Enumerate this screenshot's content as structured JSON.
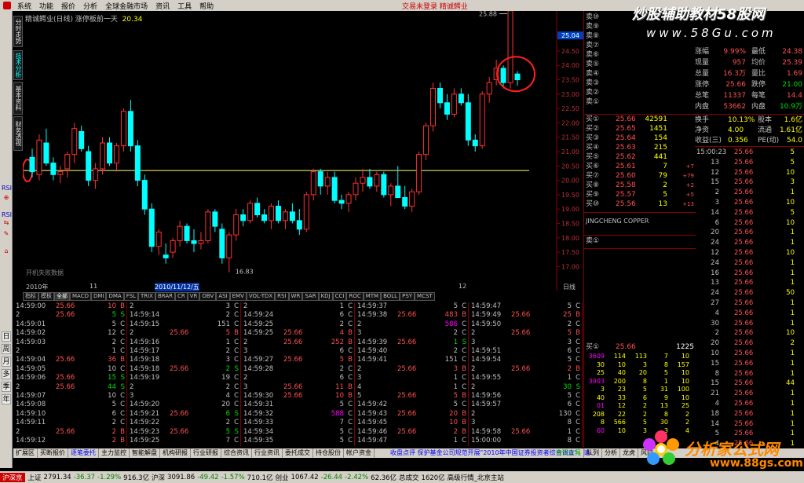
{
  "menu": {
    "items": [
      "系统",
      "功能",
      "报价",
      "分析",
      "全球金融市场",
      "资讯",
      "工具",
      "帮助"
    ],
    "notice": "交易未登录  精诚鳄业"
  },
  "chart": {
    "title": "精诚鳄业(日线) 涨停板前一天",
    "title_value": "20.34",
    "watermark": "开机失败数据",
    "high_label": "25.88",
    "low_label": "16.83",
    "level": "20.34",
    "price_ticks": [
      "25.04",
      "24.50",
      "24.00",
      "23.50",
      "23.00",
      "22.50",
      "22.00",
      "21.50",
      "21.00",
      "20.50",
      "20.00",
      "19.50",
      "19.00",
      "18.50",
      "18.00",
      "17.50",
      "17.00"
    ],
    "date_left": "2010年",
    "date_mid1": "11",
    "date_sel": "2010/11/12/五",
    "date_mid2": "12",
    "date_right": "日线",
    "colors": {
      "up": "#ff3030",
      "down": "#00ffff",
      "level": "#ffff80"
    }
  },
  "chart_data": {
    "type": "candlestick",
    "title": "精诚鳄业(日线)",
    "ylim": [
      16.6,
      25.4
    ],
    "candles": [
      [
        20.8,
        21.1,
        20.1,
        20.3
      ],
      [
        20.2,
        21.6,
        20.0,
        21.4
      ],
      [
        21.3,
        21.8,
        20.5,
        20.6
      ],
      [
        20.6,
        20.8,
        20.0,
        20.2
      ],
      [
        20.2,
        20.5,
        19.9,
        20.3
      ],
      [
        20.4,
        21.0,
        20.1,
        20.9
      ],
      [
        20.9,
        22.0,
        20.6,
        21.8
      ],
      [
        21.7,
        21.9,
        21.0,
        21.1
      ],
      [
        21.0,
        21.2,
        19.8,
        20.0
      ],
      [
        20.0,
        20.6,
        19.7,
        20.4
      ],
      [
        20.4,
        21.5,
        20.2,
        21.3
      ],
      [
        21.3,
        21.5,
        20.5,
        20.6
      ],
      [
        20.6,
        21.3,
        20.3,
        21.2
      ],
      [
        21.2,
        22.5,
        21.0,
        22.4
      ],
      [
        22.4,
        22.8,
        21.0,
        21.2
      ],
      [
        21.2,
        21.4,
        19.8,
        20.0
      ],
      [
        20.0,
        20.2,
        18.8,
        19.0
      ],
      [
        19.0,
        19.2,
        17.5,
        17.7
      ],
      [
        17.7,
        18.3,
        17.4,
        18.2
      ],
      [
        17.4,
        17.8,
        17.1,
        17.3
      ],
      [
        17.5,
        18.0,
        17.3,
        17.9
      ],
      [
        17.9,
        18.6,
        17.7,
        18.4
      ],
      [
        18.4,
        18.5,
        17.8,
        17.9
      ],
      [
        17.9,
        18.3,
        17.5,
        17.8
      ],
      [
        17.8,
        18.2,
        17.6,
        17.9
      ],
      [
        17.9,
        19.0,
        17.8,
        18.9
      ],
      [
        18.9,
        19.0,
        18.2,
        18.4
      ],
      [
        18.3,
        18.5,
        17.1,
        17.3
      ],
      [
        17.3,
        18.2,
        16.8,
        18.1
      ],
      [
        18.1,
        19.0,
        17.9,
        18.8
      ],
      [
        18.8,
        19.0,
        18.4,
        18.6
      ],
      [
        18.6,
        19.3,
        18.5,
        19.2
      ],
      [
        19.2,
        19.4,
        18.7,
        18.8
      ],
      [
        18.8,
        19.0,
        18.5,
        18.6
      ],
      [
        18.6,
        19.2,
        18.3,
        19.1
      ],
      [
        19.1,
        19.3,
        18.5,
        18.6
      ],
      [
        18.6,
        19.0,
        18.3,
        18.9
      ],
      [
        18.9,
        19.2,
        18.5,
        18.6
      ],
      [
        18.6,
        19.0,
        18.1,
        18.3
      ],
      [
        18.3,
        19.6,
        18.2,
        19.5
      ],
      [
        19.5,
        20.4,
        19.3,
        20.3
      ],
      [
        20.3,
        20.4,
        19.5,
        19.8
      ],
      [
        19.8,
        20.3,
        19.5,
        20.1
      ],
      [
        20.1,
        20.3,
        19.2,
        19.3
      ],
      [
        19.3,
        19.5,
        19.0,
        19.2
      ],
      [
        19.2,
        19.6,
        18.9,
        19.5
      ],
      [
        19.5,
        20.1,
        19.3,
        19.9
      ],
      [
        19.9,
        20.4,
        19.6,
        20.1
      ],
      [
        20.1,
        20.4,
        19.7,
        19.8
      ],
      [
        19.8,
        20.3,
        19.6,
        20.2
      ],
      [
        20.2,
        20.3,
        19.4,
        19.5
      ],
      [
        19.5,
        19.9,
        19.1,
        19.8
      ],
      [
        19.8,
        20.5,
        19.4,
        19.4
      ],
      [
        19.4,
        19.8,
        19.0,
        19.1
      ],
      [
        19.1,
        19.7,
        18.9,
        19.6
      ],
      [
        19.6,
        21.0,
        19.5,
        20.9
      ],
      [
        20.9,
        22.0,
        20.7,
        21.9
      ],
      [
        21.9,
        23.4,
        21.7,
        23.2
      ],
      [
        23.2,
        23.4,
        22.5,
        22.7
      ],
      [
        22.7,
        23.0,
        22.1,
        22.3
      ],
      [
        22.3,
        23.2,
        22.2,
        23.0
      ],
      [
        23.0,
        23.2,
        22.6,
        22.7
      ],
      [
        22.7,
        23.0,
        21.2,
        21.4
      ],
      [
        21.4,
        21.6,
        21.0,
        21.2
      ],
      [
        21.2,
        23.1,
        21.1,
        23.0
      ],
      [
        23.0,
        23.6,
        22.7,
        23.4
      ],
      [
        23.5,
        24.2,
        23.3,
        23.9
      ],
      [
        23.9,
        24.0,
        23.2,
        23.4
      ],
      [
        23.4,
        25.9,
        23.2,
        25.9
      ],
      [
        23.7,
        23.8,
        23.3,
        23.5
      ]
    ]
  },
  "indicators": [
    "指标",
    "模板",
    "全部",
    "MACD",
    "DMI",
    "DMA",
    "FSL",
    "TRIX",
    "BRAR",
    "CR",
    "VR",
    "OBV",
    "ASI",
    "EMV",
    "VOL-TDX",
    "RSI",
    "WR",
    "SAR",
    "KDJ",
    "CCI",
    "ROC",
    "MTM",
    "BOLL",
    "PSY",
    "MCST"
  ],
  "vtabs": [
    "分时走势",
    "技术分析",
    "基本资料",
    "财务透视"
  ],
  "ltools": [
    "RSI",
    "RSI"
  ],
  "lkeys": [
    "日",
    "周",
    "月",
    "多",
    "季",
    "年"
  ],
  "ticks": [
    [
      [
        "14:59:00",
        "25.66",
        "10",
        "B"
      ],
      [
        "2",
        "25.66",
        "5",
        "S"
      ],
      [
        "14:59:01",
        "",
        "5",
        "C"
      ],
      [
        "14:59:02",
        "",
        "12",
        "C"
      ],
      [
        "14:59:03",
        "",
        "2",
        "C"
      ],
      [
        "2",
        "",
        "1",
        "C"
      ],
      [
        "14:59:04",
        "25.66",
        "36",
        "B"
      ],
      [
        "14:59:05",
        "",
        "10",
        "C"
      ],
      [
        "14:59:06",
        "25.66",
        "15",
        "S"
      ],
      [
        "2",
        "25.66",
        "44",
        "S"
      ],
      [
        "14:59:07",
        "",
        "10",
        "C"
      ],
      [
        "14:59:08",
        "",
        "5",
        "C"
      ],
      [
        "14:59:10",
        "",
        "6",
        "C"
      ],
      [
        "14:59:11",
        "",
        "2",
        "C"
      ],
      [
        "2",
        "25.66",
        "2",
        "B"
      ],
      [
        "14:59:12",
        "",
        "2",
        "B"
      ]
    ],
    [
      [
        "2",
        "",
        "3",
        "C"
      ],
      [
        "14:59:14",
        "",
        "2",
        "C"
      ],
      [
        "14:59:15",
        "",
        "151",
        "C"
      ],
      [
        "2",
        "25.66",
        "5",
        "B"
      ],
      [
        "14:59:16",
        "",
        "1",
        "C"
      ],
      [
        "14:59:17",
        "",
        "2",
        "C"
      ],
      [
        "14:59:18",
        "",
        "3",
        "C"
      ],
      [
        "14:59:18",
        "25.66",
        "2",
        "S"
      ],
      [
        "14:59:19",
        "",
        "19",
        "C"
      ],
      [
        "2",
        "",
        "2",
        "C"
      ],
      [
        "3",
        "",
        "4",
        "C"
      ],
      [
        "14:59:20",
        "",
        "20",
        "C"
      ],
      [
        "14:59:21",
        "25.66",
        "6",
        "S"
      ],
      [
        "14:59:22",
        "",
        "2",
        "C"
      ],
      [
        "14:59:23",
        "25.66",
        "5",
        "S"
      ],
      [
        "14:59:25",
        "",
        "7",
        "C"
      ]
    ],
    [
      [
        "2",
        "",
        "1",
        "C"
      ],
      [
        "14:59:24",
        "",
        "6",
        "C"
      ],
      [
        "14:59:25",
        "",
        "2",
        "C"
      ],
      [
        "14:59:25",
        "25.66",
        "4",
        "B"
      ],
      [
        "2",
        "25.66",
        "252",
        "B"
      ],
      [
        "3",
        "",
        "6",
        "C"
      ],
      [
        "14:59:27",
        "25.66",
        "5",
        "B"
      ],
      [
        "14:59:28",
        "",
        "2",
        "C"
      ],
      [
        "2",
        "",
        "6",
        "C"
      ],
      [
        "3",
        "25.66",
        "11",
        "B"
      ],
      [
        "14:59:30",
        "25.66",
        "10",
        "B"
      ],
      [
        "14:59:31",
        "",
        "5",
        "C"
      ],
      [
        "14:59:32",
        "",
        "588",
        "C"
      ],
      [
        "14:59:33",
        "",
        "7",
        "C"
      ],
      [
        "14:59:34",
        "",
        "5",
        "C"
      ],
      [
        "14:59:35",
        "",
        "5",
        "C"
      ]
    ],
    [
      [
        "14:59:37",
        "",
        "5",
        "C"
      ],
      [
        "14:59:38",
        "25.66",
        "483",
        "B"
      ],
      [
        "2",
        "",
        "586",
        "C"
      ],
      [
        "3",
        "",
        "2",
        "C"
      ],
      [
        "14:59:39",
        "25.66",
        "1",
        "S"
      ],
      [
        "14:59:40",
        "",
        "2",
        "C"
      ],
      [
        "14:59:41",
        "",
        "151",
        "C"
      ],
      [
        "2",
        "25.66",
        "3",
        "B"
      ],
      [
        "3",
        "",
        "1",
        "C"
      ],
      [
        "4",
        "",
        "1",
        "C"
      ],
      [
        "5",
        "25.66",
        "5",
        "B"
      ],
      [
        "14:59:42",
        "",
        "5",
        "C"
      ],
      [
        "14:59:43",
        "25.66",
        "20",
        "B"
      ],
      [
        "14:59:45",
        "",
        "10",
        "B"
      ],
      [
        "14:59:46",
        "25.66",
        "2",
        "B"
      ],
      [
        "14:59:47",
        "",
        "1",
        "C"
      ]
    ],
    [
      [
        "14:59:47",
        "",
        "5",
        "C"
      ],
      [
        "14:59:49",
        "25.66",
        "25",
        "B"
      ],
      [
        "14:59:50",
        "",
        "2",
        "C"
      ],
      [
        "2",
        "25.66",
        "5",
        "B"
      ],
      [
        "3",
        "",
        "3",
        "C"
      ],
      [
        "14:59:51",
        "",
        "6",
        "C"
      ],
      [
        "14:59:54",
        "",
        "5",
        "C"
      ],
      [
        "2",
        "25.66",
        "2",
        "B"
      ],
      [
        "14:59:55",
        "",
        "1",
        "C"
      ],
      [
        "2",
        "",
        "30",
        "S"
      ],
      [
        "14:59:56",
        "",
        "5",
        "C"
      ],
      [
        "14:59:57",
        "",
        "6",
        "C"
      ],
      [
        "2",
        "",
        "130",
        "C"
      ],
      [
        "3",
        "",
        "8",
        "C"
      ],
      [
        "14:59:58",
        "25.66",
        "1",
        "C"
      ],
      [
        "15:00:00",
        "",
        "8",
        "C"
      ]
    ]
  ],
  "quote": {
    "sells": [
      [
        "卖⑩",
        "",
        ""
      ],
      [
        "卖⑨",
        "",
        ""
      ],
      [
        "卖⑧",
        "",
        ""
      ],
      [
        "卖⑦",
        "",
        ""
      ],
      [
        "卖⑥",
        "",
        ""
      ],
      [
        "卖⑤",
        "",
        ""
      ],
      [
        "卖④",
        "",
        ""
      ],
      [
        "卖③",
        "",
        ""
      ],
      [
        "卖②",
        "",
        ""
      ],
      [
        "卖①",
        "",
        ""
      ]
    ],
    "buys": [
      [
        "买①",
        "25.66",
        "42591",
        ""
      ],
      [
        "买②",
        "25.65",
        "1451",
        ""
      ],
      [
        "买③",
        "25.64",
        "154",
        ""
      ],
      [
        "买④",
        "25.63",
        "215",
        ""
      ],
      [
        "买⑤",
        "25.62",
        "441",
        ""
      ],
      [
        "买⑥",
        "25.61",
        "7",
        "+7"
      ],
      [
        "买⑦",
        "25.60",
        "79",
        "+79"
      ],
      [
        "买⑧",
        "25.58",
        "2",
        "+2"
      ],
      [
        "买⑨",
        "25.57",
        "5",
        "+5"
      ],
      [
        "买⑩",
        "25.56",
        "13",
        "+13"
      ]
    ],
    "eng": "JINGCHENG COPPER",
    "sell1b": "卖①",
    "buy1b": [
      "买①",
      "25.66",
      "1225"
    ],
    "queue": [
      [
        "3609",
        "114",
        "113",
        "7",
        "10"
      ],
      [
        "30",
        "10",
        "3",
        "8",
        "157"
      ],
      [
        "25",
        "40",
        "20",
        "5",
        "10"
      ],
      [
        "3903",
        "200",
        "8",
        "1",
        "10"
      ],
      [
        "3",
        "23",
        "5",
        "31",
        "100"
      ],
      [
        "40",
        "33",
        "6",
        "9",
        "10"
      ],
      [
        "01",
        "12",
        "2",
        "13",
        "25"
      ],
      [
        "208",
        "22",
        "2",
        "8",
        "2"
      ],
      [
        "8",
        "566",
        "5",
        "30",
        "2"
      ],
      [
        "60",
        "10",
        "3",
        "3",
        "4"
      ]
    ]
  },
  "right": {
    "rows": [
      [
        "涨幅",
        "9.99%",
        "最低",
        "24.38"
      ],
      [
        "现量",
        "957",
        "均价",
        "25.39"
      ],
      [
        "总量",
        "16.3万",
        "量比",
        "1.69"
      ],
      [
        "涨停",
        "25.66",
        "跌停",
        "21.00"
      ],
      [
        "总笔",
        "11337",
        "每笔",
        "14.4"
      ],
      [
        "内盘",
        "53662",
        "内盘",
        "10.9万"
      ]
    ],
    "rows2": [
      [
        "换手",
        "10.13%",
        "股本",
        "1.6亿"
      ],
      [
        "净资",
        "4.00",
        "流通",
        "1.61亿"
      ],
      [
        "收益(三)",
        "0.356",
        "PE(动)",
        "54.0"
      ]
    ],
    "ticks": [
      [
        "15:00:23",
        "25.66",
        "5",
        ""
      ],
      [
        "13",
        "25.66",
        "5",
        ""
      ],
      [
        "12",
        "25.66",
        "10",
        ""
      ],
      [
        "15",
        "25.66",
        "3",
        ""
      ],
      [
        "2",
        "25.66",
        "1",
        ""
      ],
      [
        "3",
        "25.66",
        "10",
        ""
      ],
      [
        "14",
        "25.66",
        "5",
        ""
      ],
      [
        "6",
        "25.66",
        "10",
        ""
      ],
      [
        "20",
        "25.66",
        "1",
        ""
      ],
      [
        "24",
        "25.66",
        "1",
        ""
      ],
      [
        "12",
        "25.66",
        "10",
        ""
      ],
      [
        "24",
        "25.66",
        "1",
        ""
      ],
      [
        "16",
        "25.66",
        "1",
        ""
      ],
      [
        "13",
        "25.66",
        "1",
        ""
      ],
      [
        "24",
        "25.66",
        "50",
        ""
      ],
      [
        "27",
        "25.66",
        "1",
        ""
      ],
      [
        "4",
        "25.66",
        "1",
        ""
      ],
      [
        "30",
        "25.66",
        "1",
        ""
      ],
      [
        "2",
        "25.66",
        "10",
        ""
      ],
      [
        "20",
        "25.66",
        "2",
        ""
      ],
      [
        "10",
        "25.66",
        "1",
        ""
      ],
      [
        "15",
        "25.66",
        "1",
        ""
      ],
      [
        "8",
        "25.66",
        "1",
        ""
      ],
      [
        "15",
        "25.66",
        "44",
        ""
      ],
      [
        "21",
        "25.66",
        "1",
        ""
      ],
      [
        "4",
        "25.66",
        "1",
        ""
      ],
      [
        "18",
        "25.66",
        "1",
        ""
      ],
      [
        "14",
        "25.66",
        "1",
        ""
      ],
      [
        "5",
        "25.66",
        "1",
        ""
      ],
      [
        "4",
        "25.66",
        "1",
        ""
      ]
    ]
  },
  "logo58": {
    "title": "炒股辅助教材58股网",
    "url": "www.58Gu.com"
  },
  "logo88": {
    "title": "分析家公式网",
    "url": "www.88gs.com"
  },
  "bottomtabs": [
    "扩展区",
    "买断报价",
    "逐笔委托",
    "主力监控",
    "智能解盘",
    "机构研报",
    "行业研报",
    "综合资讯",
    "行业资讯",
    "委托成交",
    "持仓股份",
    "帐户资金"
  ],
  "bottom_scroll": "收盘点评    保护基金公司规范开展\"2010年中国证券投资者综合调查\"，请...",
  "bottom_right": [
    "资讯工具",
    "队列",
    "分析",
    "龙虎",
    "风向"
  ],
  "status": {
    "name": "沪深京",
    "items": [
      "上证",
      "2791.34",
      "-36.37",
      "-1.29%",
      "916.3亿",
      "沪深",
      "3091.86",
      "-49.42",
      "-1.57%",
      "710.1亿",
      "创业",
      "1067.42",
      "-26.44",
      "-2.42%",
      "62.36亿",
      "总成交",
      "1620亿",
      "高级行情_北京主站"
    ]
  }
}
